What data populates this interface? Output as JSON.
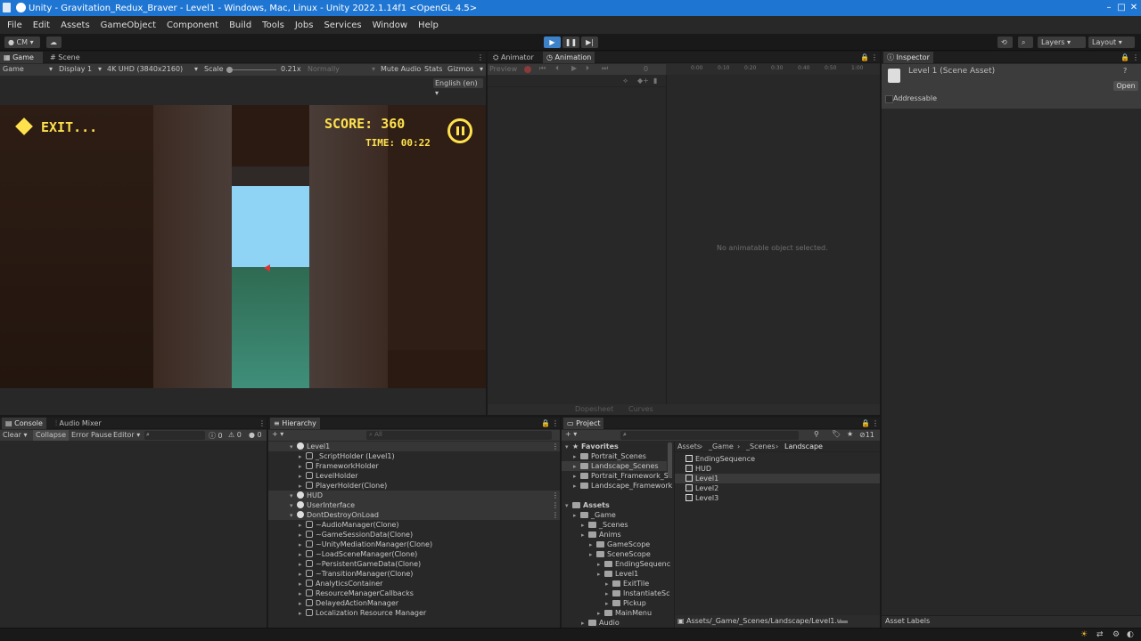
{
  "window": {
    "title": "Unity - Gravitation_Redux_Braver - Level1 - Windows, Mac, Linux - Unity 2022.1.14f1 <OpenGL 4.5>",
    "minimize": "–",
    "maximize": "□",
    "close": "✕"
  },
  "menu": [
    "File",
    "Edit",
    "Assets",
    "GameObject",
    "Component",
    "Build",
    "Tools",
    "Jobs",
    "Services",
    "Window",
    "Help"
  ],
  "toolbar": {
    "account": "CM",
    "play": "▶",
    "pause": "❚❚",
    "step": "▶|",
    "layers": "Layers",
    "layout": "Layout"
  },
  "game_panel": {
    "tabs": [
      "Game",
      "Scene"
    ],
    "mode": "Game",
    "display": "Display 1",
    "resolution": "4K UHD (3840x2160)",
    "scale_label": "Scale",
    "scale_value": "0.21x",
    "vsync": "Normally",
    "mute": "Mute Audio",
    "stats": "Stats",
    "gizmos": "Gizmos",
    "language": "English (en)",
    "hud": {
      "exit": "EXIT...",
      "score": "SCORE: 360",
      "time": "TIME: 00:22"
    }
  },
  "animation_panel": {
    "tabs": [
      "Animator",
      "Animation"
    ],
    "preview": "Preview",
    "frame": "0",
    "empty": "No animatable object selected.",
    "modes": [
      "Dopesheet",
      "Curves"
    ],
    "ruler": [
      "0:00",
      "0:10",
      "0:20",
      "0:30",
      "0:40",
      "0:50",
      "1:00"
    ]
  },
  "inspector": {
    "tab": "Inspector",
    "asset": "Level 1 (Scene Asset)",
    "open": "Open",
    "addressable": "Addressable",
    "asset_labels": "Asset Labels"
  },
  "console": {
    "tabs": [
      "Console",
      "Audio Mixer"
    ],
    "clear": "Clear",
    "collapse": "Collapse",
    "error_pause": "Error Pause",
    "editor": "Editor",
    "counts": [
      "0",
      "0",
      "0"
    ]
  },
  "hierarchy": {
    "tab": "Hierarchy",
    "search_placeholder": "All",
    "rows": [
      {
        "label": "Level1",
        "indent": 0,
        "kind": "scene"
      },
      {
        "label": "_ScriptHolder (Level1)",
        "indent": 1,
        "kind": "go"
      },
      {
        "label": "FrameworkHolder",
        "indent": 1,
        "kind": "go"
      },
      {
        "label": "LevelHolder",
        "indent": 1,
        "kind": "go"
      },
      {
        "label": "PlayerHolder(Clone)",
        "indent": 1,
        "kind": "go"
      },
      {
        "label": "HUD",
        "indent": 0,
        "kind": "scene"
      },
      {
        "label": "UserInterface",
        "indent": 0,
        "kind": "scene"
      },
      {
        "label": "DontDestroyOnLoad",
        "indent": 0,
        "kind": "scene"
      },
      {
        "label": "~AudioManager(Clone)",
        "indent": 1,
        "kind": "go"
      },
      {
        "label": "~GameSessionData(Clone)",
        "indent": 1,
        "kind": "go"
      },
      {
        "label": "~UnityMediationManager(Clone)",
        "indent": 1,
        "kind": "go"
      },
      {
        "label": "~LoadSceneManager(Clone)",
        "indent": 1,
        "kind": "go"
      },
      {
        "label": "~PersistentGameData(Clone)",
        "indent": 1,
        "kind": "go"
      },
      {
        "label": "~TransitionManager(Clone)",
        "indent": 1,
        "kind": "go"
      },
      {
        "label": "AnalyticsContainer",
        "indent": 1,
        "kind": "go"
      },
      {
        "label": "ResourceManagerCallbacks",
        "indent": 1,
        "kind": "go"
      },
      {
        "label": "DelayedActionManager",
        "indent": 1,
        "kind": "go"
      },
      {
        "label": "Localization Resource Manager",
        "indent": 1,
        "kind": "go"
      }
    ]
  },
  "project": {
    "tab": "Project",
    "badge": "11",
    "favorites_label": "Favorites",
    "favorites": [
      "Portrait_Scenes",
      "Landscape_Scenes",
      "Portrait_Framework_Sc",
      "Landscape_Framework"
    ],
    "assets_label": "Assets",
    "tree": [
      {
        "label": "_Game",
        "indent": 1
      },
      {
        "label": "_Scenes",
        "indent": 2
      },
      {
        "label": "Anims",
        "indent": 2
      },
      {
        "label": "GameScope",
        "indent": 3
      },
      {
        "label": "SceneScope",
        "indent": 3
      },
      {
        "label": "EndingSequenc",
        "indent": 4
      },
      {
        "label": "Level1",
        "indent": 4
      },
      {
        "label": "ExitTile",
        "indent": 5
      },
      {
        "label": "InstantiateSc",
        "indent": 5
      },
      {
        "label": "Pickup",
        "indent": 5
      },
      {
        "label": "MainMenu",
        "indent": 4
      },
      {
        "label": "Audio",
        "indent": 2
      }
    ],
    "breadcrumb": [
      "Assets",
      "_Game",
      "_Scenes",
      "Landscape"
    ],
    "files": [
      "EndingSequence",
      "HUD",
      "Level1",
      "Level2",
      "Level3"
    ],
    "path": "Assets/_Game/_Scenes/Landscape/Level1.u"
  },
  "colors": {
    "titlebar": "#1f76d2",
    "hud_yellow": "#ffe14d",
    "sky": "#8fd3f5",
    "floor": "#3b8a6a"
  }
}
